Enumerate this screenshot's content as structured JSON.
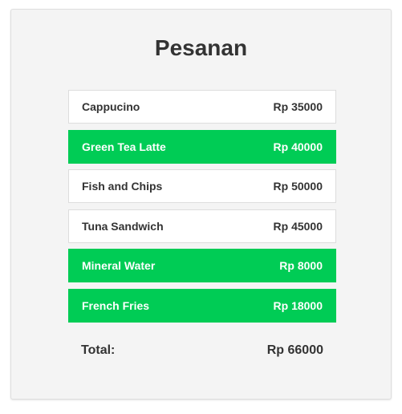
{
  "title": "Pesanan",
  "colors": {
    "selected_bg": "#00cc55",
    "card_bg": "#f4f4f4",
    "text": "#333333"
  },
  "items": [
    {
      "name": "Cappucino",
      "price": "Rp 35000",
      "selected": false
    },
    {
      "name": "Green Tea Latte",
      "price": "Rp 40000",
      "selected": true
    },
    {
      "name": "Fish and Chips",
      "price": "Rp 50000",
      "selected": false
    },
    {
      "name": "Tuna Sandwich",
      "price": "Rp 45000",
      "selected": false
    },
    {
      "name": "Mineral Water",
      "price": "Rp 8000",
      "selected": true
    },
    {
      "name": "French Fries",
      "price": "Rp 18000",
      "selected": true
    }
  ],
  "total": {
    "label": "Total:",
    "value": "Rp 66000"
  }
}
